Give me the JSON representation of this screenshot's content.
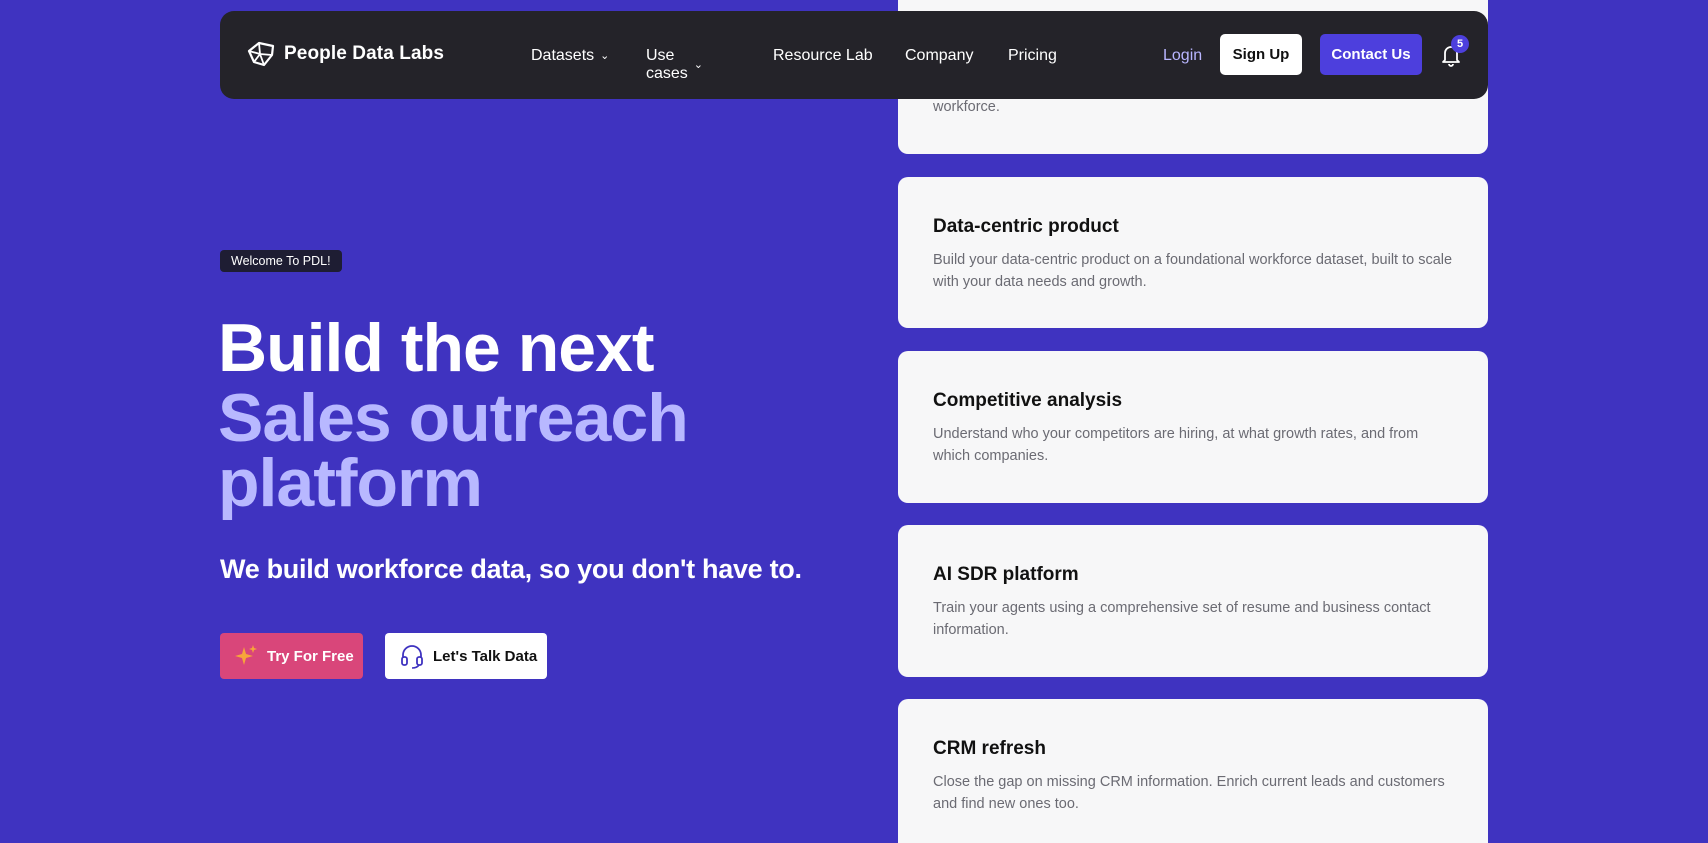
{
  "nav": {
    "brand": "People Data Labs",
    "items": [
      {
        "label": "Datasets",
        "dropdown": true
      },
      {
        "label": "Use cases",
        "dropdown": true
      },
      {
        "label": "Resource Lab",
        "dropdown": false
      },
      {
        "label": "Company",
        "dropdown": false
      },
      {
        "label": "Pricing",
        "dropdown": false
      }
    ],
    "login": "Login",
    "signup": "Sign Up",
    "contact": "Contact Us",
    "notification_count": "5"
  },
  "hero": {
    "badge": "Welcome To PDL!",
    "headline_line1": "Build the next",
    "headline_highlight": "Sales outreach platform",
    "subhead": "We build workforce data, so you don't have to.",
    "cta_primary": "Try For Free",
    "cta_secondary": "Let's Talk Data"
  },
  "use_cases": [
    {
      "title": "",
      "description": "workforce."
    },
    {
      "title": "Data-centric product",
      "description": "Build your data-centric product on a foundational workforce dataset, built to scale with your data needs and growth."
    },
    {
      "title": "Competitive analysis",
      "description": "Understand who your competitors are hiring, at what growth rates, and from which companies."
    },
    {
      "title": "AI SDR platform",
      "description": "Train your agents using a comprehensive set of resume and business contact information."
    },
    {
      "title": "CRM refresh",
      "description": "Close the gap on missing CRM information. Enrich current leads and customers and find new ones too."
    }
  ],
  "colors": {
    "background": "#3f33c0",
    "navbar": "#242329",
    "accent": "#4d3fdd",
    "highlight_text": "#b8b8ff",
    "cta_primary": "#d9467a"
  }
}
